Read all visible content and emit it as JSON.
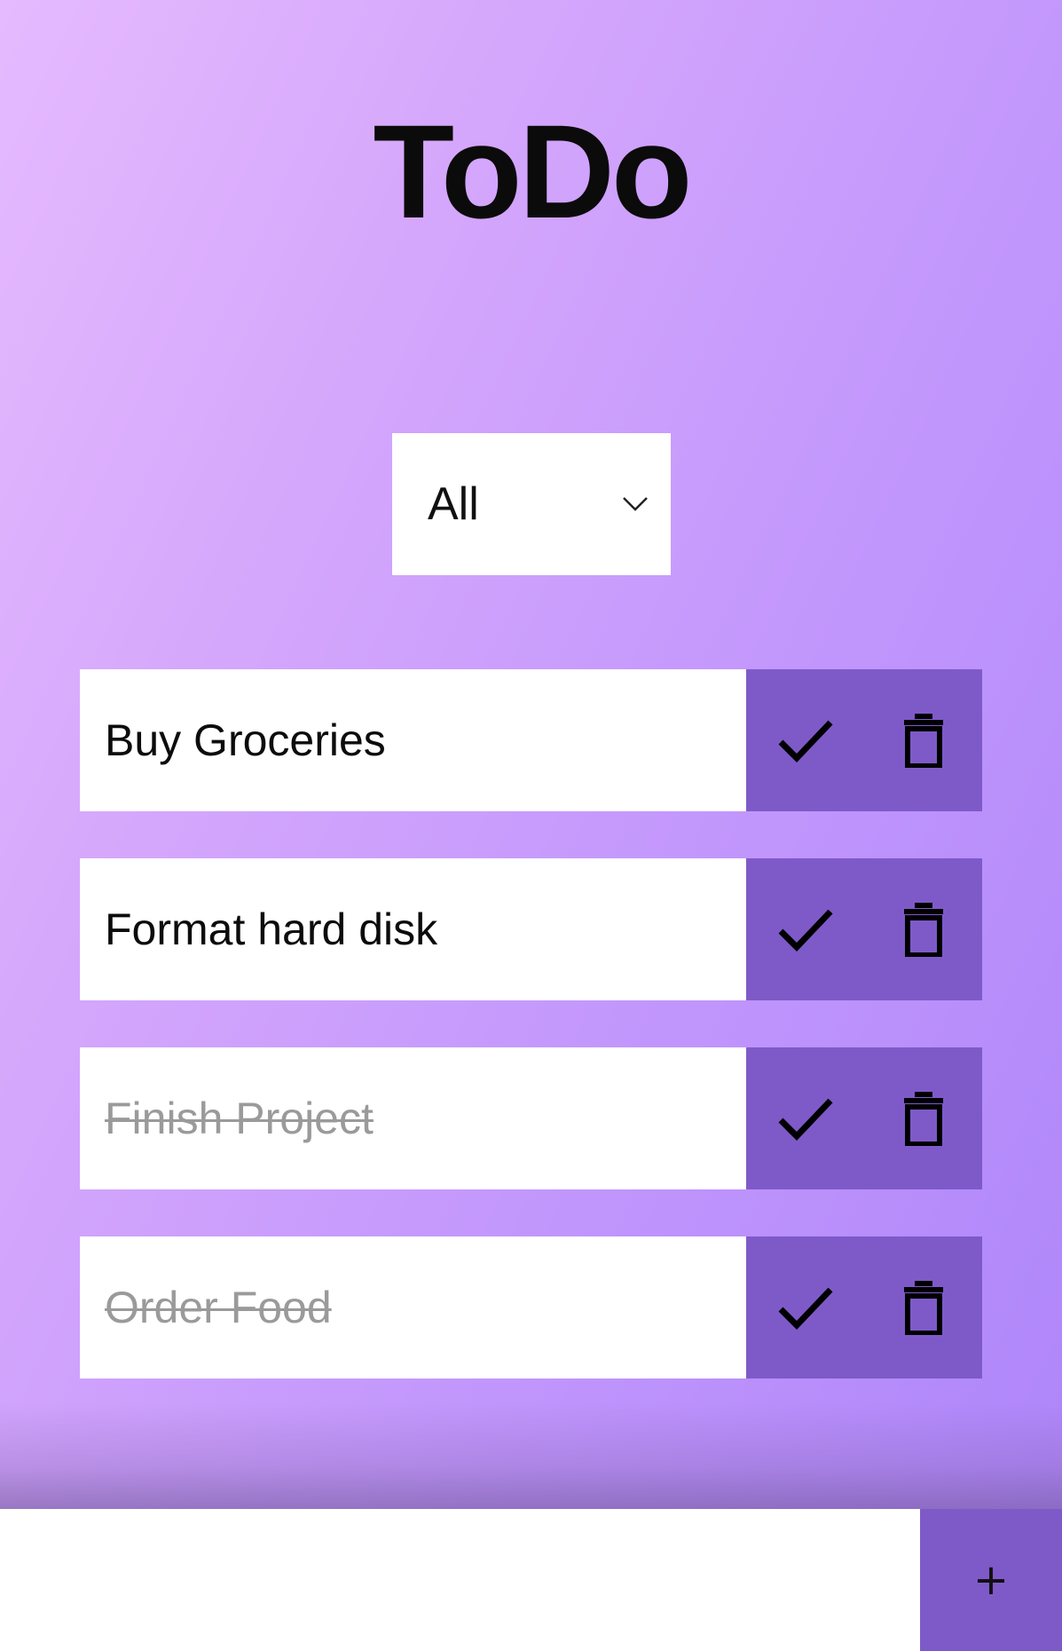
{
  "app": {
    "title": "ToDo"
  },
  "filter": {
    "selected": "All"
  },
  "todos": [
    {
      "text": "Buy Groceries",
      "completed": false
    },
    {
      "text": "Format hard disk",
      "completed": false
    },
    {
      "text": "Finish Project",
      "completed": true
    },
    {
      "text": "Order Food",
      "completed": true
    }
  ],
  "add_bar": {
    "input_value": "",
    "button_label": "+"
  },
  "icons": {
    "complete": "check-icon",
    "delete": "trash-icon",
    "dropdown": "chevron-down-icon"
  },
  "colors": {
    "accent": "#7e5ac9",
    "completed_text": "#9a9a9a",
    "background_start": "#e6bafe",
    "background_end": "#ad84fa"
  }
}
